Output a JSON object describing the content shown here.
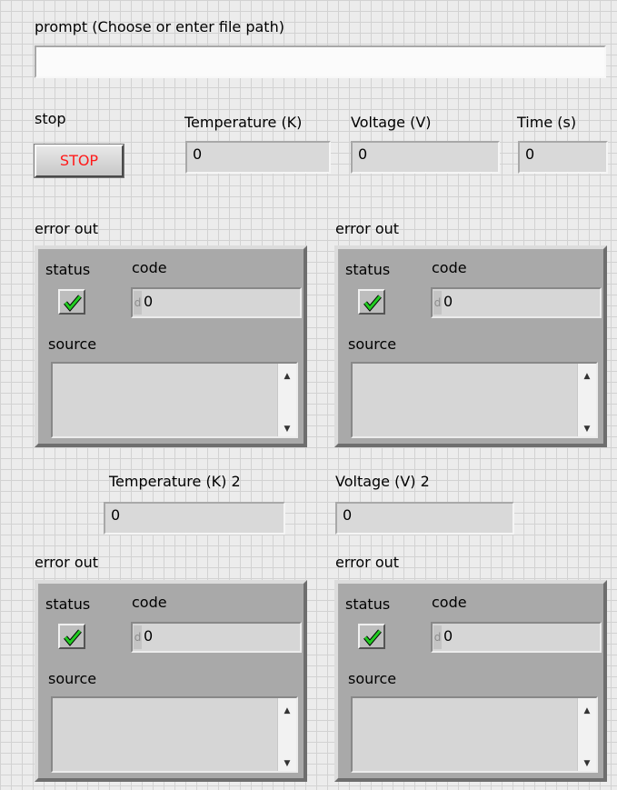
{
  "prompt": {
    "label": "prompt (Choose or enter file path)",
    "value": ""
  },
  "stop": {
    "label": "stop",
    "button_text": "STOP"
  },
  "temperature": {
    "label": "Temperature (K)",
    "value": "0"
  },
  "voltage": {
    "label": "Voltage (V)",
    "value": "0"
  },
  "time": {
    "label": "Time (s)",
    "value": "0"
  },
  "temperature2": {
    "label": "Temperature (K) 2",
    "value": "0"
  },
  "voltage2": {
    "label": "Voltage (V) 2",
    "value": "0"
  },
  "error_clusters": [
    {
      "label": "error out",
      "status_label": "status",
      "code_label": "code",
      "code_radix": "d",
      "code_value": "0",
      "source_label": "source",
      "source_value": ""
    },
    {
      "label": "error out",
      "status_label": "status",
      "code_label": "code",
      "code_radix": "d",
      "code_value": "0",
      "source_label": "source",
      "source_value": ""
    },
    {
      "label": "error out",
      "status_label": "status",
      "code_label": "code",
      "code_radix": "d",
      "code_value": "0",
      "source_label": "source",
      "source_value": ""
    },
    {
      "label": "error out",
      "status_label": "status",
      "code_label": "code",
      "code_radix": "d",
      "code_value": "0",
      "source_label": "source",
      "source_value": ""
    }
  ],
  "icons": {
    "status_ok": "green-checkmark-icon",
    "scroll_up": "triangle-up-icon",
    "scroll_down": "triangle-down-icon"
  },
  "colors": {
    "stop_text": "#ff1a1a",
    "status_ok": "#22cc22"
  }
}
